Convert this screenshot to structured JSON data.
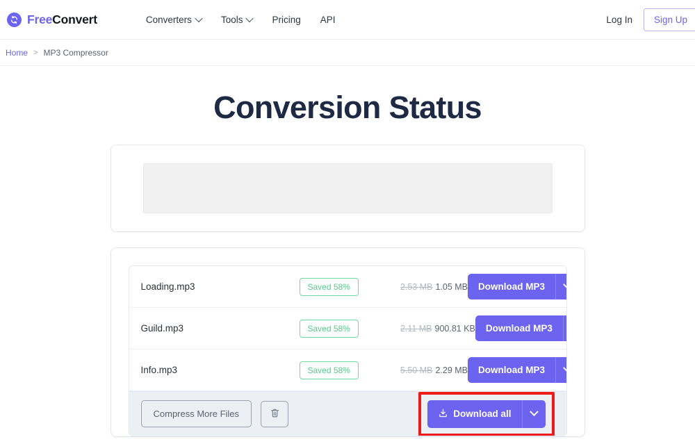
{
  "header": {
    "brand": {
      "part1": "Free",
      "part2": "Convert",
      "icon": "sync-circle-icon"
    },
    "nav": [
      {
        "label": "Converters",
        "has_caret": true
      },
      {
        "label": "Tools",
        "has_caret": true
      },
      {
        "label": "Pricing",
        "has_caret": false
      },
      {
        "label": "API",
        "has_caret": false
      }
    ],
    "login_label": "Log In",
    "signup_label": "Sign Up"
  },
  "breadcrumb": {
    "home": "Home",
    "separator": ">",
    "current": "MP3 Compressor"
  },
  "main": {
    "title": "Conversion Status",
    "files": [
      {
        "name": "Loading.mp3",
        "saved": "Saved 58%",
        "size_original": "2.53 MB",
        "size_new": "1.05 MB",
        "download_label": "Download MP3"
      },
      {
        "name": "Guild.mp3",
        "saved": "Saved 58%",
        "size_original": "2.11 MB",
        "size_new": "900.81 KB",
        "download_label": "Download MP3"
      },
      {
        "name": "Info.mp3",
        "saved": "Saved 58%",
        "size_original": "5.50 MB",
        "size_new": "2.29 MB",
        "download_label": "Download MP3"
      }
    ],
    "actions": {
      "compress_more_label": "Compress More Files",
      "delete_icon": "trash-icon",
      "download_all_label": "Download all",
      "download_all_icon": "download-icon"
    }
  },
  "colors": {
    "accent": "#6c63f0",
    "success": "#55ca8c",
    "highlight": "#ee1b1b",
    "title": "#1e2a44"
  }
}
